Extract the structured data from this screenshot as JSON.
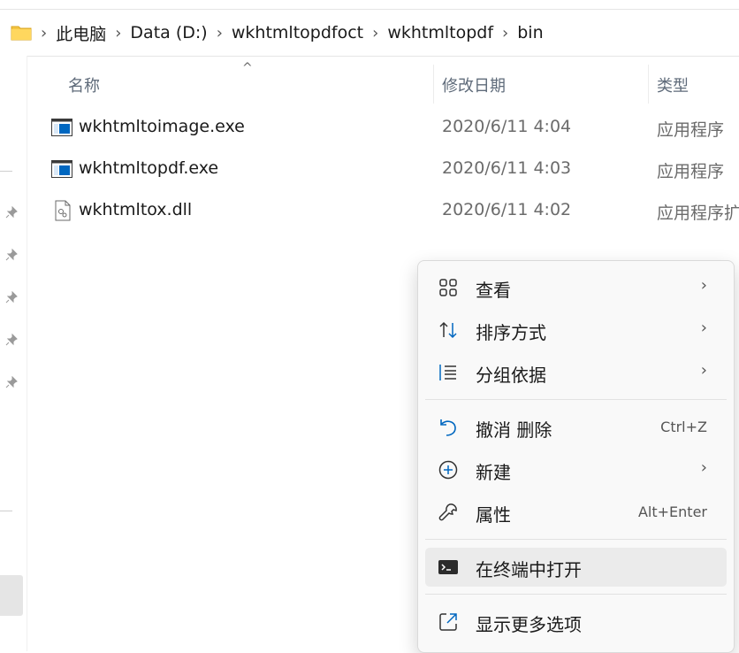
{
  "breadcrumb": {
    "items": [
      "此电脑",
      "Data (D:)",
      "wkhtmltopdfoct",
      "wkhtmltopdf",
      "bin"
    ],
    "separator": "›"
  },
  "columns": {
    "name": "名称",
    "date": "修改日期",
    "type": "类型"
  },
  "files": [
    {
      "name": "wkhtmltoimage.exe",
      "date": "2020/6/11 4:04",
      "type": "应用程序",
      "icon": "exe-icon"
    },
    {
      "name": "wkhtmltopdf.exe",
      "date": "2020/6/11 4:03",
      "type": "应用程序",
      "icon": "exe-icon"
    },
    {
      "name": "wkhtmltox.dll",
      "date": "2020/6/11 4:02",
      "type": "应用程序扩展",
      "icon": "dll-icon"
    }
  ],
  "context_menu": {
    "items": [
      {
        "label": "查看",
        "icon": "view-grid-icon",
        "submenu": true
      },
      {
        "label": "排序方式",
        "icon": "sort-icon",
        "submenu": true
      },
      {
        "label": "分组依据",
        "icon": "group-by-icon",
        "submenu": true
      },
      {
        "label": "撤消 删除",
        "icon": "undo-icon",
        "shortcut": "Ctrl+Z"
      },
      {
        "label": "新建",
        "icon": "new-icon",
        "submenu": true
      },
      {
        "label": "属性",
        "icon": "wrench-icon",
        "shortcut": "Alt+Enter"
      },
      {
        "label": "在终端中打开",
        "icon": "terminal-icon",
        "highlighted": true
      },
      {
        "label": "显示更多选项",
        "icon": "more-options-icon"
      }
    ]
  },
  "colors": {
    "accent": "#0067c0",
    "folder": "#f4c542",
    "menu_bg": "#f9f9f9",
    "hover": "#ebebeb"
  }
}
